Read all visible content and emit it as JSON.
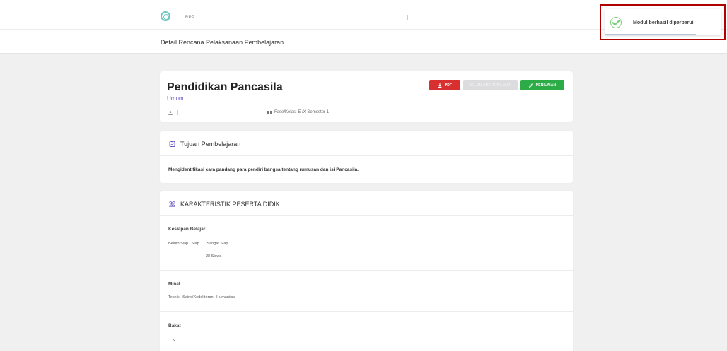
{
  "topbar": {
    "brand": "RPP",
    "logo_icon": "app-logo-icon"
  },
  "subbar": {
    "title": "Detail Rencana Pelaksanaan Pembelajaran"
  },
  "subject": {
    "title": "Pendidikan Pancasila",
    "category": "Umum",
    "fase_kelas": "Fase/Kelas: E /X Semester 1",
    "buttons": {
      "pdf": "PDF",
      "disabled": "BELUM ADA PENILAIAN",
      "penilaian": "PENILAIAN"
    }
  },
  "tujuan": {
    "heading": "Tujuan Pembelajaran",
    "text": "Mengidentifikasi cara pandang para pendiri bangsa tentang rumusan dan isi Pancasila."
  },
  "karakteristik": {
    "heading": "KARAKTERISTIK PESERTA DIDIK",
    "kesiapan": {
      "label": "Kesiapan Belajar",
      "options": "Belum Siap   Siap       Sangat Siap",
      "count": "28 Siswa"
    },
    "minat": {
      "label": "Minat",
      "options": "Teknik   Sains/Kedokteran   Humaniora"
    },
    "bakat": {
      "label": "Bakat",
      "value": "v"
    }
  },
  "toast": {
    "message": "Modul berhasil diperbarui",
    "progress": 0.78
  },
  "colors": {
    "danger": "#d83030",
    "success": "#2cab46",
    "accent": "#6a56c8"
  }
}
